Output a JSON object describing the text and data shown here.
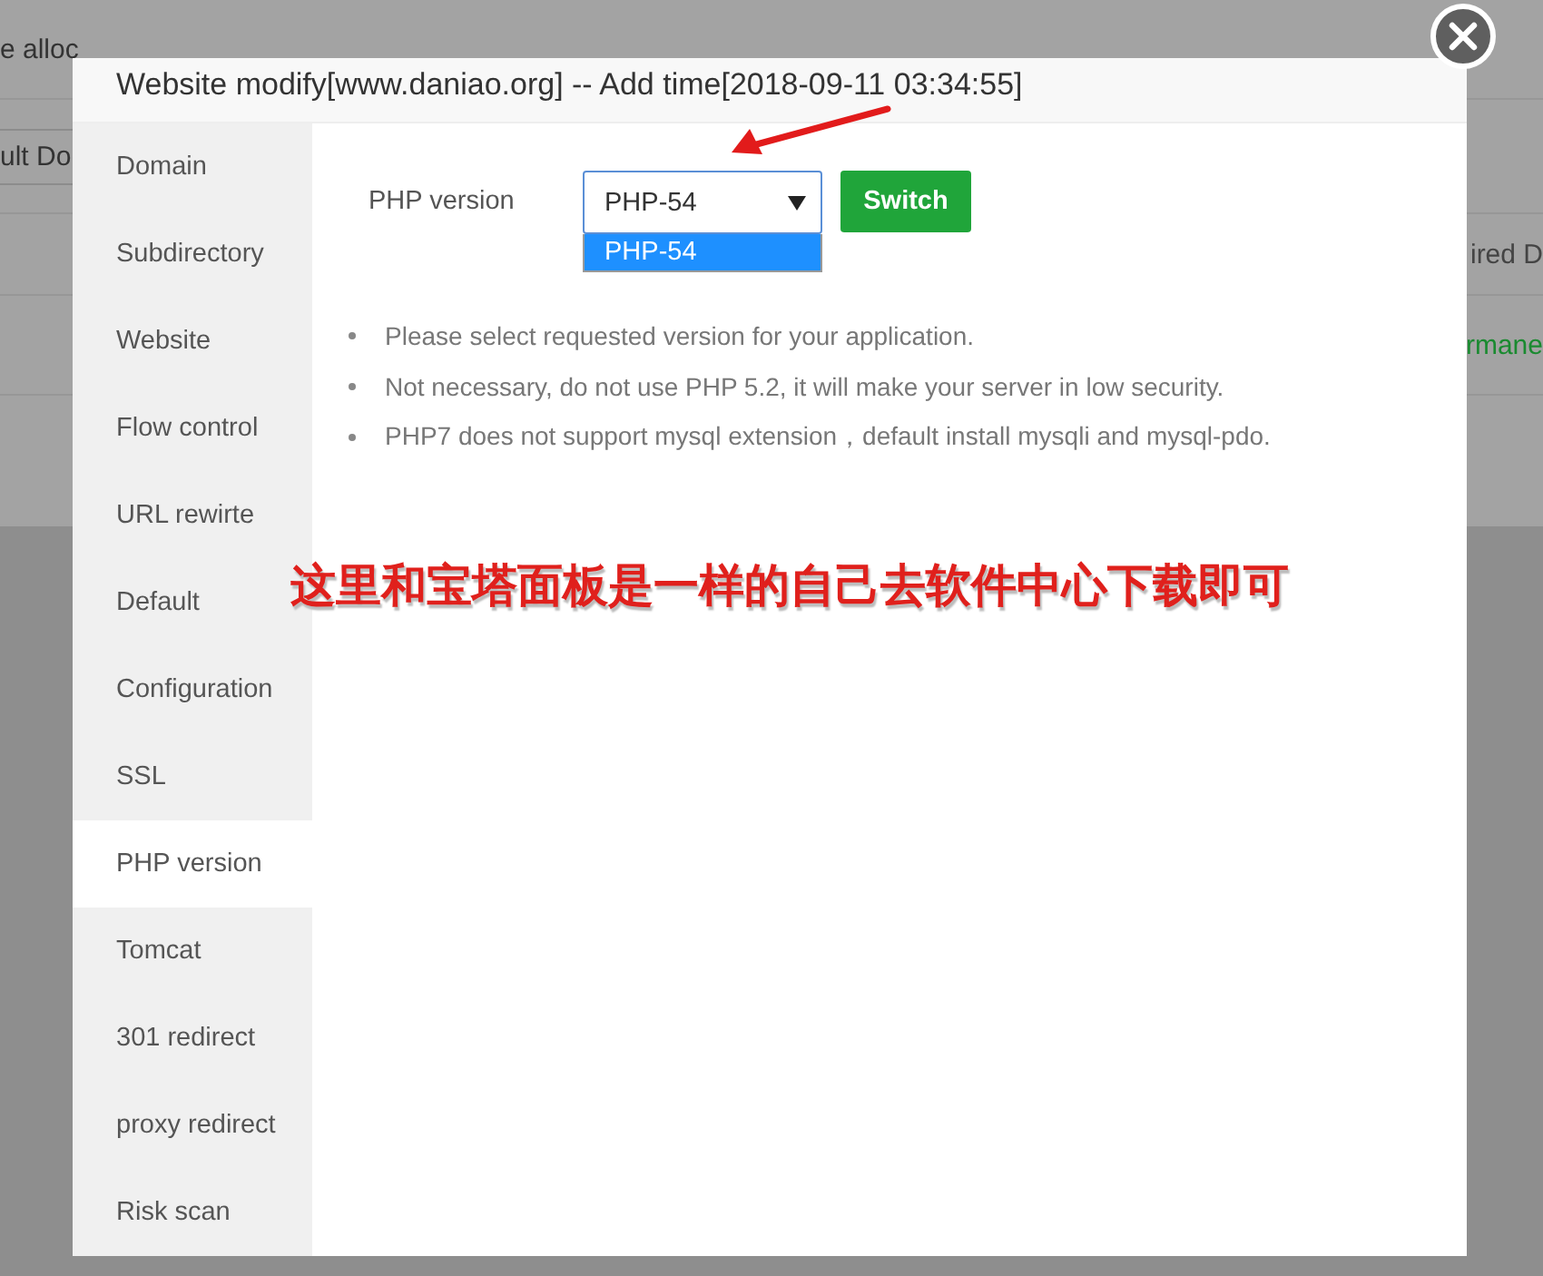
{
  "background_page": {
    "rows": [
      {
        "kind": "plain",
        "cells": [
          {
            "text": "e alloc",
            "color": "#333333"
          }
        ]
      },
      {
        "kind": "field",
        "cells": [
          {
            "text": "ult Do",
            "color": "#333333"
          }
        ]
      },
      {
        "kind": "header",
        "cells": [
          {
            "text": "ired D",
            "color": "#444444"
          }
        ]
      },
      {
        "kind": "plain",
        "cells": [
          {
            "text": "rmane",
            "color": "#1a8a30"
          }
        ]
      }
    ]
  },
  "dialog": {
    "title": "Website modify[www.daniao.org] -- Add time[2018-09-11 03:34:55]",
    "sidebar": {
      "items": [
        {
          "label": "Domain",
          "selected": false
        },
        {
          "label": "Subdirectory",
          "selected": false
        },
        {
          "label": "Website",
          "selected": false
        },
        {
          "label": "Flow control",
          "selected": false
        },
        {
          "label": "URL rewirte",
          "selected": false
        },
        {
          "label": "Default",
          "selected": false
        },
        {
          "label": "Configuration",
          "selected": false
        },
        {
          "label": "SSL",
          "selected": false
        },
        {
          "label": "PHP version",
          "selected": true
        },
        {
          "label": "Tomcat",
          "selected": false
        },
        {
          "label": "301 redirect",
          "selected": false
        },
        {
          "label": "proxy redirect",
          "selected": false
        },
        {
          "label": "Risk scan",
          "selected": false
        }
      ]
    },
    "php_version": {
      "label": "PHP version",
      "select": {
        "value": "PHP-54",
        "expanded": true,
        "options": [
          {
            "label": "PHP-54",
            "selected": true
          }
        ]
      },
      "button": "Switch"
    },
    "notes": [
      "Please select requested version for your application.",
      "Not necessary, do not use PHP 5.2, it will make your server in low security.",
      "PHP7 does not support mysql extension，default install mysqli and mysql-pdo."
    ]
  },
  "annotation": {
    "text": "这里和宝塔面板是一样的自己去软件中心下载即可"
  }
}
